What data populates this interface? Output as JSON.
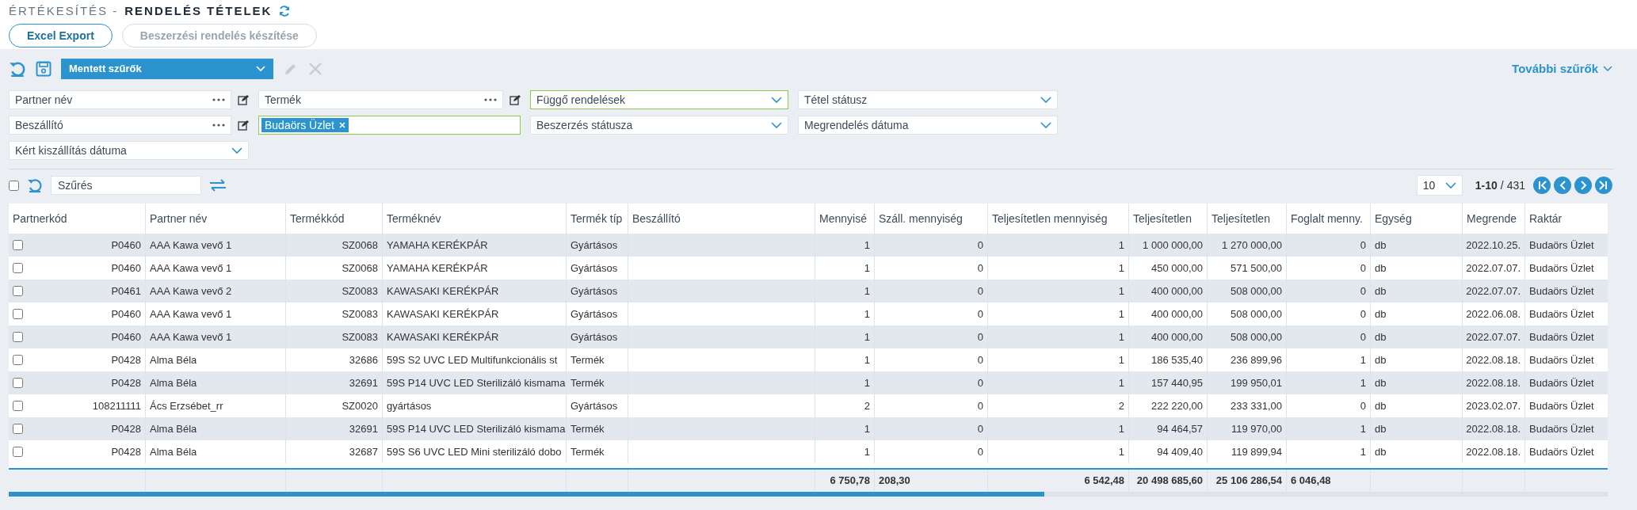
{
  "header": {
    "section": "ÉRTÉKESÍTÉS -",
    "title": "RENDELÉS TÉTELEK"
  },
  "actions": [
    {
      "label": "Excel Export",
      "disabled": false
    },
    {
      "label": "Beszerzési rendelés készítése",
      "disabled": true
    }
  ],
  "filter_bar": {
    "saved_filters": "Mentett szűrők",
    "more_filters": "További szűrők",
    "rows": [
      [
        {
          "kind": "lookup",
          "placeholder": "Partner név",
          "active": false
        },
        {
          "kind": "lookup",
          "placeholder": "Termék",
          "active": false
        },
        {
          "kind": "select",
          "value": "Függő rendelések",
          "active": true
        },
        {
          "kind": "select",
          "placeholder": "Tétel státusz",
          "active": false
        }
      ],
      [
        {
          "kind": "lookup",
          "placeholder": "Beszállító",
          "active": false
        },
        {
          "kind": "tags",
          "tags": [
            "Budaörs Üzlet"
          ],
          "active": true
        },
        {
          "kind": "select",
          "placeholder": "Beszerzés státusza",
          "active": false
        },
        {
          "kind": "select",
          "placeholder": "Megrendelés dátuma",
          "active": false
        }
      ],
      [
        {
          "kind": "select",
          "placeholder": "Kért kiszállítás dátuma",
          "active": false
        }
      ]
    ]
  },
  "table_toolbar": {
    "select_all_checked": false,
    "search_placeholder": "Szűrés",
    "page_size": "10",
    "range": "1-10",
    "total": "/ 431"
  },
  "table": {
    "columns": [
      {
        "label": "Partnerkód",
        "kind": "number"
      },
      {
        "label": "Partner név",
        "kind": "text"
      },
      {
        "label": "Termékkód",
        "kind": "number"
      },
      {
        "label": "Terméknév",
        "kind": "text"
      },
      {
        "label": "Termék típ",
        "kind": "text"
      },
      {
        "label": "Beszállító",
        "kind": "text"
      },
      {
        "label": "Mennyisé",
        "kind": "number",
        "total": "6 750,78"
      },
      {
        "label": "Száll. mennyiség",
        "kind": "number",
        "total": "208,30"
      },
      {
        "label": "Teljesítetlen mennyiség",
        "kind": "number",
        "total": "6 542,48"
      },
      {
        "label": "Teljesítetlen",
        "kind": "number",
        "total": "20 498 685,60"
      },
      {
        "label": "Teljesítetlen",
        "kind": "number",
        "total": "25 106 286,54"
      },
      {
        "label": "Foglalt menny.",
        "kind": "number",
        "total": "6 046,48"
      },
      {
        "label": "Egység",
        "kind": "text"
      },
      {
        "label": "Megrende",
        "kind": "number"
      },
      {
        "label": "Raktár",
        "kind": "text"
      }
    ],
    "rows": [
      {
        "checked": false,
        "cells": [
          "P0460",
          "AAA Kawa vevő 1",
          "SZ0068",
          "YAMAHA KERÉKPÁR",
          "Gyártásos",
          "",
          "1",
          "0",
          "1",
          "1 000 000,00",
          "1 270 000,00",
          "0",
          "db",
          "2022.10.25.",
          "Budaörs Üzlet"
        ]
      },
      {
        "checked": false,
        "cells": [
          "P0460",
          "AAA Kawa vevő 1",
          "SZ0068",
          "YAMAHA KERÉKPÁR",
          "Gyártásos",
          "",
          "1",
          "0",
          "1",
          "450 000,00",
          "571 500,00",
          "0",
          "db",
          "2022.07.07.",
          "Budaörs Üzlet"
        ]
      },
      {
        "checked": false,
        "cells": [
          "P0461",
          "AAA Kawa vevő 2",
          "SZ0083",
          "KAWASAKI KERÉKPÁR",
          "Gyártásos",
          "",
          "1",
          "0",
          "1",
          "400 000,00",
          "508 000,00",
          "0",
          "db",
          "2022.07.07.",
          "Budaörs Üzlet"
        ]
      },
      {
        "checked": false,
        "cells": [
          "P0460",
          "AAA Kawa vevő 1",
          "SZ0083",
          "KAWASAKI KERÉKPÁR",
          "Gyártásos",
          "",
          "1",
          "0",
          "1",
          "400 000,00",
          "508 000,00",
          "0",
          "db",
          "2022.06.08.",
          "Budaörs Üzlet"
        ]
      },
      {
        "checked": false,
        "cells": [
          "P0460",
          "AAA Kawa vevő 1",
          "SZ0083",
          "KAWASAKI KERÉKPÁR",
          "Gyártásos",
          "",
          "1",
          "0",
          "1",
          "400 000,00",
          "508 000,00",
          "0",
          "db",
          "2022.07.07.",
          "Budaörs Üzlet"
        ]
      },
      {
        "checked": false,
        "cells": [
          "P0428",
          "Alma Béla",
          "32686",
          "59S S2 UVC LED Multifunkcionális st",
          "Termék",
          "",
          "1",
          "0",
          "1",
          "186 535,40",
          "236 899,96",
          "1",
          "db",
          "2022.08.18.",
          "Budaörs Üzlet"
        ]
      },
      {
        "checked": false,
        "cells": [
          "P0428",
          "Alma Béla",
          "32691",
          "59S P14 UVC LED Sterilizáló kismama",
          "Termék",
          "",
          "1",
          "0",
          "1",
          "157 440,95",
          "199 950,01",
          "1",
          "db",
          "2022.08.18.",
          "Budaörs Üzlet"
        ]
      },
      {
        "checked": false,
        "cells": [
          "108211111",
          "Ács Erzsébet_rr",
          "SZ0020",
          "gyártásos",
          "Gyártásos",
          "",
          "2",
          "0",
          "2",
          "222 220,00",
          "233 331,00",
          "0",
          "db",
          "2023.02.07.",
          "Budaörs Üzlet"
        ]
      },
      {
        "checked": false,
        "cells": [
          "P0428",
          "Alma Béla",
          "32691",
          "59S P14 UVC LED Sterilizáló kismama",
          "Termék",
          "",
          "1",
          "0",
          "1",
          "94 464,57",
          "119 970,00",
          "1",
          "db",
          "2022.08.18.",
          "Budaörs Üzlet"
        ]
      },
      {
        "checked": false,
        "cells": [
          "P0428",
          "Alma Béla",
          "32687",
          "59S S6 UVC LED Mini sterilizáló dobo",
          "Termék",
          "",
          "1",
          "0",
          "1",
          "94 409,40",
          "119 899,94",
          "1",
          "db",
          "2022.08.18.",
          "Budaörs Üzlet"
        ]
      }
    ]
  }
}
